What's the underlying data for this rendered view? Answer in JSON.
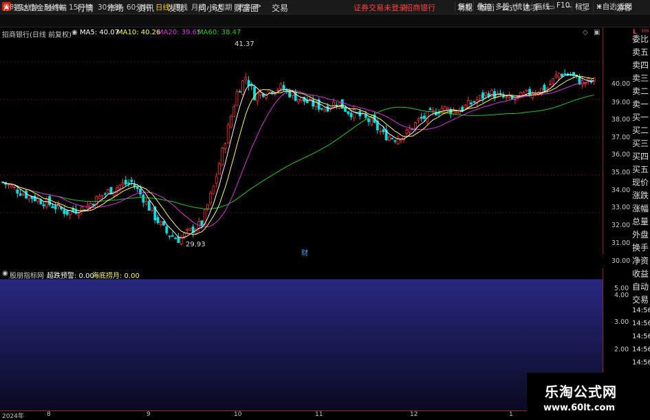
{
  "app": {
    "title": "通达信金融终端",
    "broker_status": "证券交易未登录",
    "stock_link": "招商银行"
  },
  "menu": [
    "行情",
    "市场",
    "资讯",
    "发现",
    "问小达",
    "财富圈",
    "交易"
  ],
  "right_menu": [
    "功能",
    "版面",
    "公式",
    "选项"
  ],
  "guest_label": "游客",
  "periods": [
    "分时",
    "1分钟",
    "5分钟",
    "15分钟",
    "30分钟",
    "60分钟",
    "日线",
    "周线",
    "月线",
    "多周期",
    "更多"
  ],
  "active_period": "日线",
  "toolbar": [
    "复权",
    "叠加",
    "多股",
    "统计",
    "画线",
    "F10",
    "标记",
    "+自选",
    "返回"
  ],
  "chart": {
    "stock_title": "招商银行(日线 前复权)",
    "ma5": "MA5: 40.07",
    "ma10": "MA10: 40.26",
    "ma20": "MA20: 39.65",
    "ma60": "MA60: 38.47",
    "high_label": "41.37",
    "low_label": "29.93",
    "event_marker": "财"
  },
  "price_ticks": [
    "40.00",
    "39.00",
    "38.00",
    "37.00",
    "36.00",
    "35.00",
    "34.00",
    "33.00",
    "32.00",
    "31.00",
    "30.00"
  ],
  "side_items": [
    "委比",
    "卖五",
    "卖四",
    "卖三",
    "卖二",
    "卖一",
    "买一",
    "买二",
    "买三",
    "买四",
    "买五",
    "现价",
    "涨跌",
    "涨幅",
    "总量",
    "外盘",
    "换手",
    "净资",
    "收益",
    "自动",
    "交易",
    "14:56",
    "14:56",
    "14:56",
    "14:56",
    "14:56",
    "14:56",
    "14:56"
  ],
  "indicator": {
    "name": "股朋指标网",
    "label1": "超跌预警: 0.00",
    "label2": "海底捞月: 0.00",
    "ticks": [
      "5.00",
      "4.00",
      "3.00",
      "2.00"
    ]
  },
  "time_axis": [
    "2024年",
    "8",
    "9",
    "10",
    "11",
    "12",
    "1"
  ],
  "watermark": {
    "title": "乐淘公式网",
    "url": "www.60lt.com"
  },
  "colors": {
    "up": "#ff3030",
    "down": "#00e0e0",
    "ma5": "#ffffff",
    "ma10": "#ffff55",
    "ma20": "#dd33dd",
    "ma60": "#22cc22"
  }
}
